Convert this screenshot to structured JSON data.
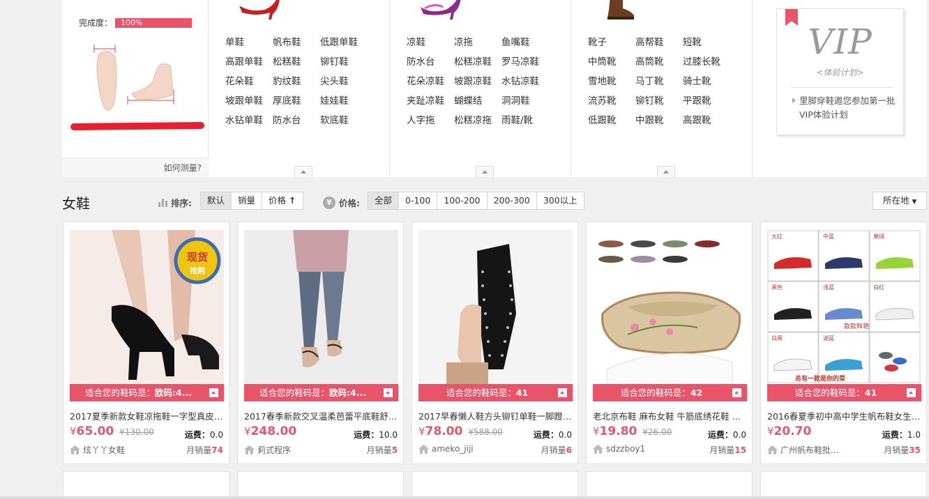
{
  "measure": {
    "complete_label": "完成度：",
    "complete_value": "100%",
    "complete_fraction": 1.0,
    "howto_link": "如何测量?"
  },
  "categories": [
    {
      "icon": "red-high-heel-icon",
      "items": [
        "单鞋",
        "帆布鞋",
        "低跟单鞋",
        "高跟单鞋",
        "松糕鞋",
        "铆钉鞋",
        "花朵鞋",
        "豹纹鞋",
        "尖头鞋",
        "坡跟单鞋",
        "厚底鞋",
        "娃娃鞋",
        "水钻单鞋",
        "防水台",
        "软底鞋"
      ]
    },
    {
      "icon": "purple-sandal-icon",
      "items": [
        "凉鞋",
        "凉拖",
        "鱼嘴鞋",
        "防水台",
        "松糕凉鞋",
        "罗马凉鞋",
        "花朵凉鞋",
        "坡跟凉鞋",
        "水钻凉鞋",
        "夹趾凉鞋",
        "蝴蝶结",
        "洞洞鞋",
        "人字拖",
        "松糕凉拖",
        "雨鞋/靴"
      ]
    },
    {
      "icon": "brown-boot-icon",
      "items": [
        "靴子",
        "高帮鞋",
        "短靴",
        "中筒靴",
        "高筒靴",
        "过膝长靴",
        "雪地靴",
        "马丁靴",
        "骑士靴",
        "流苏靴",
        "铆钉靴",
        "平跟靴",
        "低跟靴",
        "中跟靴",
        "高跟靴"
      ]
    }
  ],
  "vip": {
    "title": "VIP",
    "subtitle": "<体验计划>",
    "text": "里脚穿鞋邀您参加第一批VIP体验计划"
  },
  "sortbar": {
    "section_title": "女鞋",
    "sort_label": "排序:",
    "sort_options": [
      "默认",
      "销量",
      "价格"
    ],
    "sort_active": "默认",
    "price_label": "价格:",
    "price_icon": "¥",
    "price_options": [
      "全部",
      "0-100",
      "100-200",
      "200-300",
      "300以上"
    ],
    "price_active": "全部",
    "location_button": "所在地"
  },
  "products": [
    {
      "name": "2017夏季新款女鞋凉拖鞋一字型真皮防水台高跟拖鞋",
      "fit_label": "适合您的鞋码是：",
      "fit_size": "欧码:4...",
      "currency": "¥",
      "price": "65.00",
      "orig_price": "¥130.00",
      "ship_label": "运费：",
      "ship_value": "0.0",
      "shop": "炫丫丫女鞋",
      "sales_label": "月销量",
      "sales": "74",
      "badge": "现货",
      "badge2": "抢购"
    },
    {
      "name": "2017春季新款交叉温柔芭蕾平底鞋舒适百搭",
      "fit_label": "适合您的鞋码是：",
      "fit_size": "欧码:4...",
      "currency": "¥",
      "price": "248.00",
      "orig_price": "",
      "ship_label": "运费：",
      "ship_value": "10.0",
      "shop": "莉式程序",
      "sales_label": "月销量",
      "sales": "5"
    },
    {
      "name": "2017早春懒人鞋方头铆钉单鞋一脚蹬乐福鞋",
      "fit_label": "适合您的鞋码是：",
      "fit_size": "41",
      "currency": "¥",
      "price": "78.00",
      "orig_price": "¥588.00",
      "ship_label": "运费：",
      "ship_value": "0.0",
      "shop": "ameko_jiji",
      "sales_label": "月销量",
      "sales": "6"
    },
    {
      "name": "老北京布鞋 麻布女鞋 牛筋底绣花鞋 女款单鞋",
      "fit_label": "适合您的鞋码是：",
      "fit_size": "42",
      "currency": "¥",
      "price": "19.80",
      "orig_price": "¥26.00",
      "ship_label": "运费：",
      "ship_value": "0.0",
      "shop": "sdzzboy1",
      "sales_label": "月销量",
      "sales": "15"
    },
    {
      "name": "2016春夏季初中高中学生帆布鞋女生球鞋",
      "fit_label": "适合您的鞋码是：",
      "fit_size": "41",
      "currency": "¥",
      "price": "20.70",
      "orig_price": "",
      "ship_label": "运费：",
      "ship_value": "1.0",
      "shop": "广州帆布鞋批...",
      "sales_label": "月销量",
      "sales": "35",
      "grid_labels": [
        "大红",
        "中蓝",
        "果绿",
        "黑色",
        "浅蓝",
        "白红",
        "白黑",
        "湖蓝",
        "款款鲜艳",
        "总有一款是你的菜"
      ]
    }
  ],
  "colors": {
    "accent": "#e9546b",
    "background": "#f0f0f0"
  }
}
